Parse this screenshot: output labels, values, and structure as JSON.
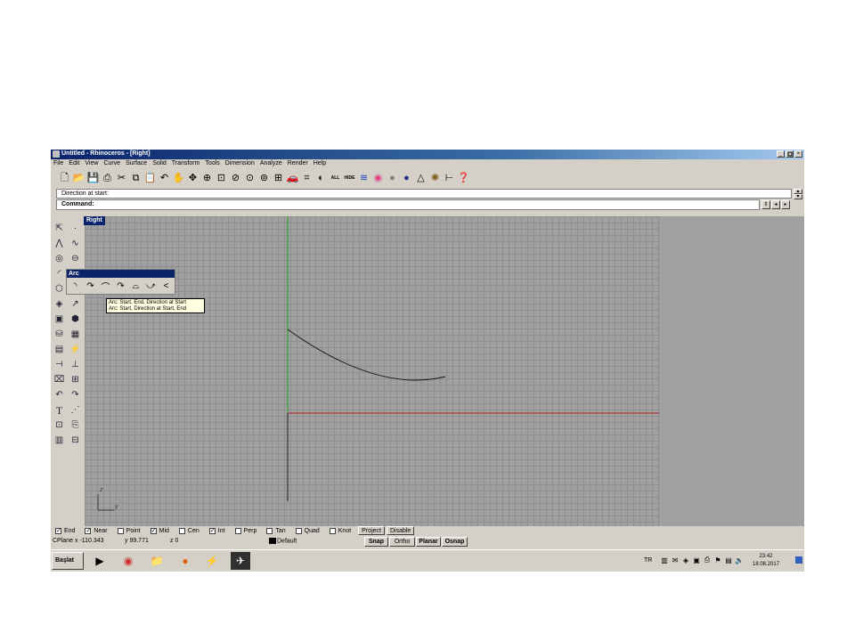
{
  "window": {
    "title": "Untitled - Rhinoceros - [Right]",
    "controls": [
      "_",
      "×"
    ]
  },
  "menu": [
    "File",
    "Edit",
    "View",
    "Curve",
    "Surface",
    "Solid",
    "Transform",
    "Tools",
    "Dimension",
    "Analyze",
    "Render",
    "Help"
  ],
  "toolbar_icons": [
    "new-icon",
    "open-icon",
    "save-icon",
    "print-icon",
    "cut-icon",
    "copy-icon",
    "paste-icon",
    "undo-icon",
    "pan-icon",
    "rotate-view-icon",
    "zoom-icon",
    "zoom-window-icon",
    "zoom-extents-icon",
    "zoom-selected-icon",
    "zoom-dynamic-icon",
    "four-viewports-icon",
    "car-icon",
    "grid-icon",
    "show-icon",
    "hide-icon",
    "layers-icon",
    "color-wheel-icon",
    "render-sphere-icon",
    "material-sphere-icon",
    "light-icon",
    "settings-icon",
    "dimension-icon",
    "help-icon"
  ],
  "toolbar_labels": {
    "all": "ALL",
    "hide": "HIDE"
  },
  "command": {
    "history": "Direction at start:",
    "prompt": "Command:"
  },
  "viewport": {
    "label": "Right",
    "axis_labels": {
      "z": "z",
      "y": "y"
    },
    "colors": {
      "background": "#a0a0a0",
      "grid": "#8e8e8e",
      "x_axis": "#b42020",
      "y_axis": "#20a020",
      "curve": "#1a1a1a"
    }
  },
  "arc_panel": {
    "title": "Arc"
  },
  "tooltip": {
    "lines": [
      "Arc: Start, End, Direction at Start",
      "Arc: Start, Direction at Start, End"
    ]
  },
  "osnap": {
    "options": [
      {
        "label": "End",
        "checked": true
      },
      {
        "label": "Near",
        "checked": true
      },
      {
        "label": "Point",
        "checked": false
      },
      {
        "label": "Mid",
        "checked": true
      },
      {
        "label": "Cen",
        "checked": false
      },
      {
        "label": "Int",
        "checked": true
      },
      {
        "label": "Perp",
        "checked": false
      },
      {
        "label": "Tan",
        "checked": false
      },
      {
        "label": "Quad",
        "checked": false
      },
      {
        "label": "Knot",
        "checked": false
      }
    ],
    "buttons": [
      "Project",
      "Disable"
    ]
  },
  "status": {
    "cplane": "CPlane",
    "x": "x -110.343",
    "y": "y 99.771",
    "z": "z 0",
    "layer": "Default",
    "toggles": [
      "Snap",
      "Ortho",
      "Planar",
      "Osnap"
    ]
  },
  "taskbar": {
    "start": "Başlat",
    "apps": [
      "media-player-icon",
      "chrome-icon",
      "folder-icon",
      "firefox-icon",
      "app-icon",
      "rhino-icon"
    ],
    "lang": "TR",
    "time": "23:42",
    "date": "18.08.2017"
  }
}
